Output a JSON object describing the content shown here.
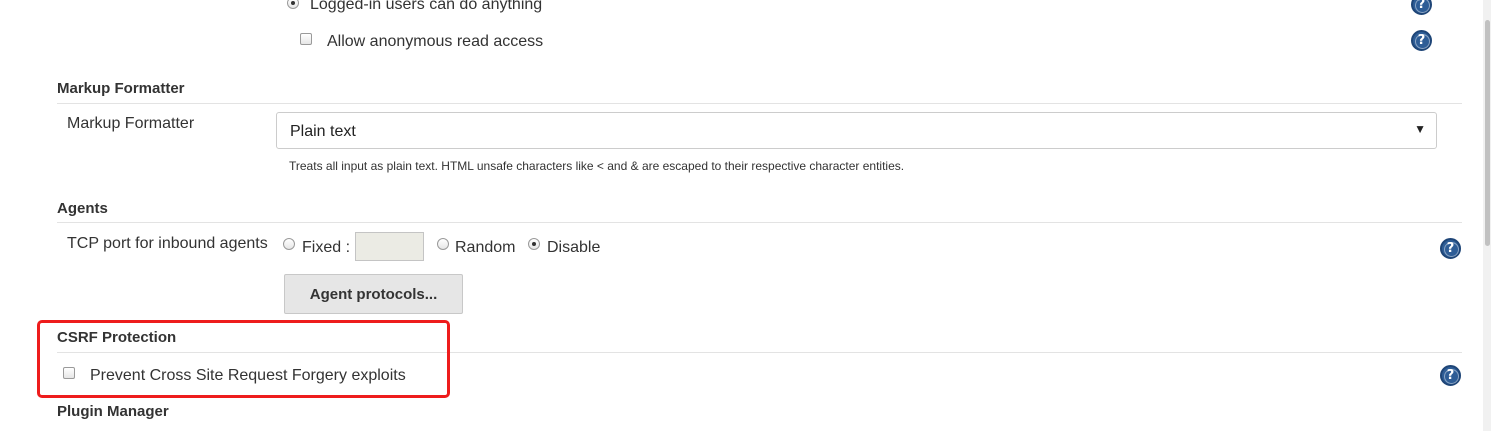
{
  "authorization": {
    "logged_in_option": "Logged-in users can do anything",
    "anonymous_read": "Allow anonymous read access"
  },
  "markup_formatter": {
    "section_title": "Markup Formatter",
    "field_label": "Markup Formatter",
    "selected_value": "Plain text",
    "arrow": "▼",
    "description": "Treats all input as plain text. HTML unsafe characters like < and & are escaped to their respective character entities."
  },
  "agents": {
    "section_title": "Agents",
    "tcp_label": "TCP port for inbound agents",
    "fixed_label": "Fixed :",
    "fixed_value": "",
    "random_label": "Random",
    "disable_label": "Disable",
    "selected": "Disable",
    "protocols_button": "Agent protocols..."
  },
  "csrf": {
    "section_title": "CSRF Protection",
    "prevent_label": "Prevent Cross Site Request Forgery exploits",
    "checked": false
  },
  "plugin_manager": {
    "section_title": "Plugin Manager"
  },
  "colors": {
    "highlight": "#ee1c1c",
    "help_icon": "#2e5d96"
  }
}
